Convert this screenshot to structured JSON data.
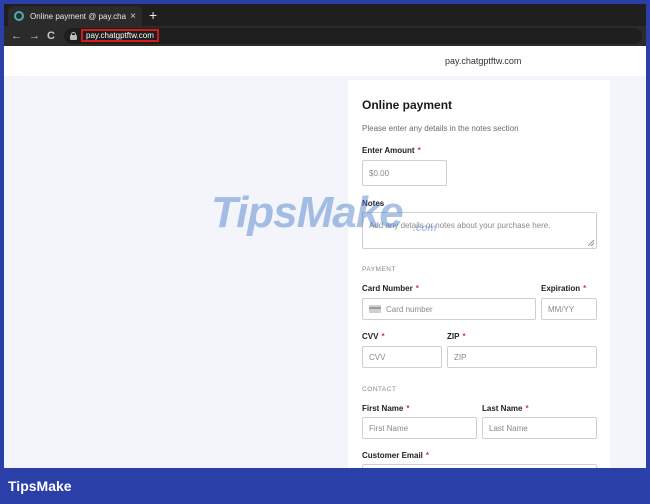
{
  "browser": {
    "tab_title": "Online payment @ pay.chatgptft",
    "tab_close": "×",
    "new_tab": "+",
    "back": "←",
    "forward": "→",
    "reload": "C",
    "url": "pay.chatgptftw.com"
  },
  "page": {
    "domain": "pay.chatgptftw.com",
    "title": "Online payment",
    "subtitle": "Please enter any details in the notes section",
    "amount": {
      "label": "Enter Amount",
      "required": "*",
      "placeholder": "$0.00"
    },
    "notes": {
      "label": "Notes",
      "placeholder": "Add any details or notes about your purchase here."
    },
    "payment_section": "PAYMENT",
    "card_number": {
      "label": "Card Number",
      "required": "*",
      "placeholder": "Card number"
    },
    "expiration": {
      "label": "Expiration",
      "required": "*",
      "placeholder": "MM/YY"
    },
    "cvv": {
      "label": "CVV",
      "required": "*",
      "placeholder": "CVV"
    },
    "zip": {
      "label": "ZIP",
      "required": "*",
      "placeholder": "ZIP"
    },
    "contact_section": "CONTACT",
    "first_name": {
      "label": "First Name",
      "required": "*",
      "placeholder": "First Name"
    },
    "last_name": {
      "label": "Last Name",
      "required": "*",
      "placeholder": "Last Name"
    },
    "email": {
      "label": "Customer Email",
      "required": "*"
    }
  },
  "watermark": {
    "text": "TipsMake",
    "suffix": ".com"
  },
  "footer": {
    "brand": "TipsMake"
  },
  "colors": {
    "frame": "#2a3fa8",
    "url_highlight": "#d11a1a",
    "required": "#d23b3b"
  }
}
